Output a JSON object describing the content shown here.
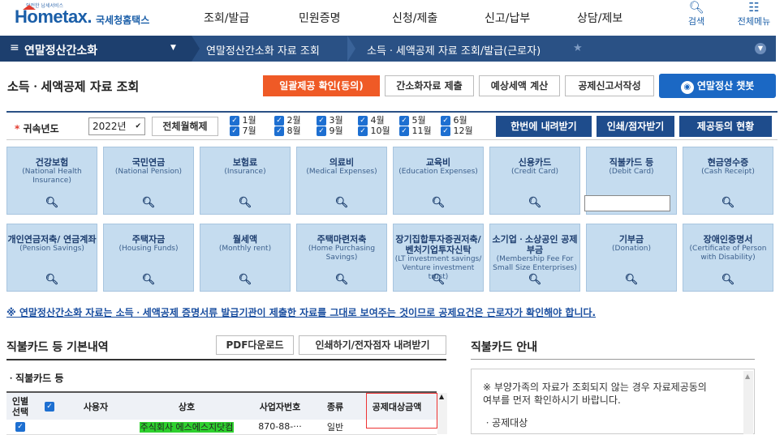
{
  "header": {
    "logo_small": "안전한 납세서비스",
    "logo_main": "Hometax.",
    "logo_kr": "국세청홈택스",
    "menu": [
      "조회/발급",
      "민원증명",
      "신청/제출",
      "신고/납부",
      "상담/제보"
    ],
    "search_label": "검색",
    "allmenu_label": "전체메뉴"
  },
  "nav": {
    "section": "연말정산간소화",
    "crumb1": "연말정산간소화 자료 조회",
    "crumb2": "소득ㆍ세액공제 자료 조회/발급(근로자)"
  },
  "page": {
    "title": "소득ㆍ세액공제 자료 조회",
    "buttons": {
      "bulk_consent": "일괄제공 확인(동의)",
      "simple_submit": "간소화자료 제출",
      "tax_calc": "예상세액 계산",
      "deduction_form": "공제신고서작성",
      "chatbot": "연말정산 챗봇"
    }
  },
  "filter": {
    "year_label": "귀속년도",
    "year_value": "2022년",
    "clear_months": "전체월해제",
    "months": [
      "1월",
      "2월",
      "3월",
      "4월",
      "5월",
      "6월",
      "7월",
      "8월",
      "9월",
      "10월",
      "11월",
      "12월"
    ],
    "download_once": "한번에 내려받기",
    "print": "인쇄/점자받기",
    "provider_status": "제공동의 현황"
  },
  "tiles": [
    {
      "title": "건강보험",
      "en": "(National Health Insurance)"
    },
    {
      "title": "국민연금",
      "en": "(National Pension)"
    },
    {
      "title": "보험료",
      "en": "(Insurance)"
    },
    {
      "title": "의료비",
      "en": "(Medical Expenses)"
    },
    {
      "title": "교육비",
      "en": "(Education Expenses)"
    },
    {
      "title": "신용카드",
      "en": "(Credit Card)"
    },
    {
      "title": "직불카드 등",
      "en": "(Debit Card)"
    },
    {
      "title": "현금영수증",
      "en": "(Cash Receipt)"
    },
    {
      "title": "개인연금저축/ 연금계좌",
      "en": "(Pension Savings)"
    },
    {
      "title": "주택자금",
      "en": "(Housing Funds)"
    },
    {
      "title": "월세액",
      "en": "(Monthly rent)"
    },
    {
      "title": "주택마련저축",
      "en": "(Home Purchasing Savings)"
    },
    {
      "title": "장기집합투자증권저축/ 벤처기업투자신탁",
      "en": "(LT investment savings/ Venture investment trust)"
    },
    {
      "title": "소기업ㆍ소상공인 공제부금",
      "en": "(Membership Fee For Small Size Enterprises)"
    },
    {
      "title": "기부금",
      "en": "(Donation)"
    },
    {
      "title": "장애인증명서",
      "en": "(Certificate of Person with Disability)"
    }
  ],
  "notice": "※ 연말정산간소화 자료는 소득ㆍ세액공제 증명서류 발급기관이 제출한 자료를 그대로 보여주는 것이므로 공제요건은 근로자가 확인해야 합니다.",
  "left_section": {
    "title": "직불카드 등 기본내역",
    "pdf_btn": "PDF다운로드",
    "print_btn": "인쇄하기/전자점자 내려받기",
    "subtitle": "직불카드 등",
    "columns": [
      "인별 선택",
      "",
      "사용자",
      "상호",
      "사업자번호",
      "종류",
      "공제대상금액"
    ],
    "row": {
      "company": "주식회사 에스에스지닷컴",
      "bizno": "870-88-···",
      "kind": "일반"
    }
  },
  "right_section": {
    "title": "직불카드 안내",
    "line1": "※ 부양가족의 자료가 조회되지 않는 경우 자료제공동의",
    "line2": "여부를 먼저 확인하시기 바랍니다.",
    "line3": "ㆍ공제대상"
  }
}
